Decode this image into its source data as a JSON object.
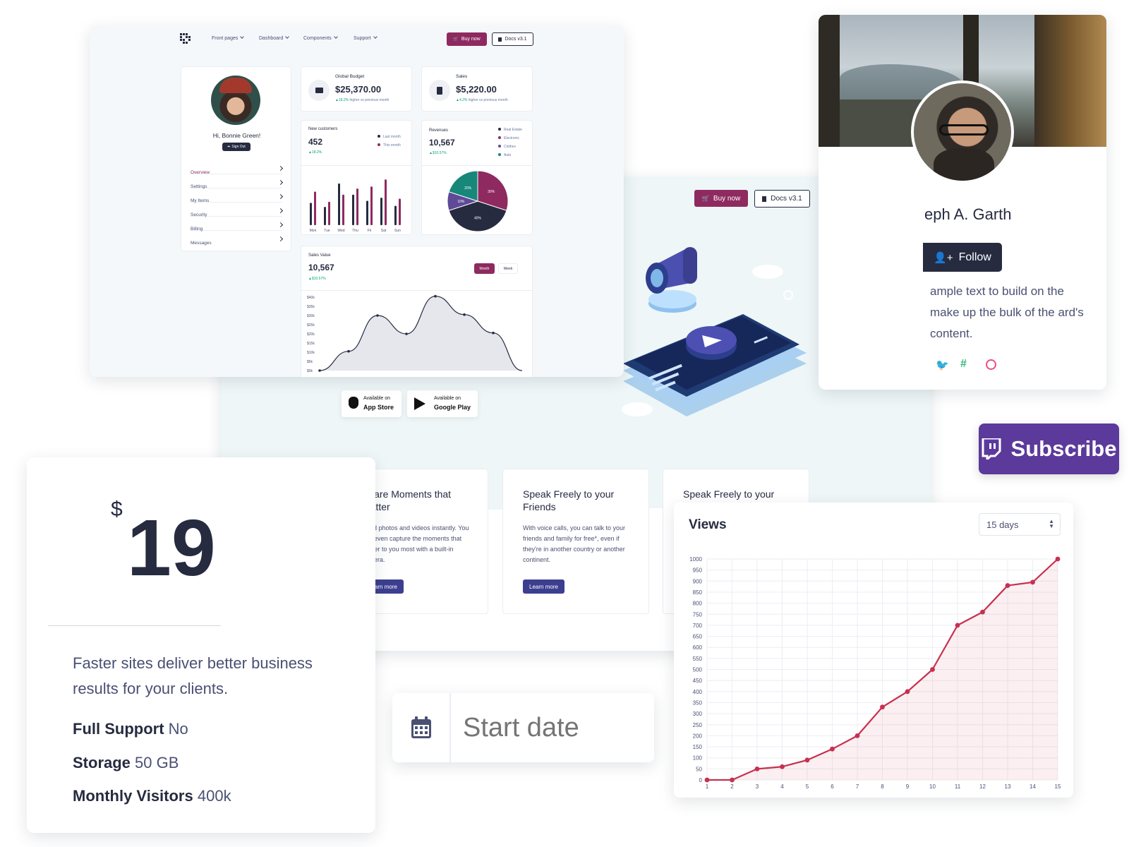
{
  "dashboard": {
    "nav": [
      "Front pages",
      "Dashboard",
      "Components",
      "Support"
    ],
    "buy_now": "Buy now",
    "docs": "Docs v3.1",
    "greeting": "Hi, Bonnie Green!",
    "sign_out": "Sign Out",
    "menu": [
      "Overview",
      "Settings",
      "My Items",
      "Security",
      "Billing",
      "Messages"
    ],
    "global_budget": {
      "label": "Global Budget",
      "value": "$25,370.00",
      "change": "18.2%",
      "note": "higher vs previous month"
    },
    "sales": {
      "label": "Sales",
      "value": "$5,220.00",
      "change": "4.2%",
      "note": "higher vs previous month"
    },
    "new_customers": {
      "label": "New customers",
      "value": "452",
      "change": "18.2%",
      "legend": [
        "Last month",
        "This month"
      ]
    },
    "revenues": {
      "label": "Revenues",
      "value": "10,567",
      "change": "$10.57%",
      "legend": [
        "Real Estate",
        "Electronic",
        "Clothes",
        "Auto"
      ]
    },
    "sales_value": {
      "label": "Sales Value",
      "value": "10,567",
      "change": "$10.57%",
      "month": "Month",
      "week": "Week"
    }
  },
  "landing": {
    "buy_now": "Buy now",
    "docs": "Docs v3.1",
    "app_store": {
      "small": "Available on",
      "big": "App Store"
    },
    "google_play": {
      "small": "Available on",
      "big": "Google Play"
    },
    "features": [
      {
        "title": "Share Moments that Matter",
        "text": "Send photos and videos instantly. You can even capture the moments that matter to you most with a built-in camera.",
        "button": "Learn more"
      },
      {
        "title": "Speak Freely to your Friends",
        "text": "With voice calls, you can talk to your friends and family for free*, even if they're in another country or another continent.",
        "button": "Learn more"
      },
      {
        "title": "Speak Freely to your",
        "text": "",
        "button": ""
      }
    ]
  },
  "profile": {
    "name": "eph A. Garth",
    "follow": "Follow",
    "text": "ample text to build on the make up the bulk of the ard's content."
  },
  "subscribe": {
    "label": "Subscribe"
  },
  "pricing": {
    "currency": "$",
    "price": "19",
    "description": "Faster sites deliver better business results for your clients.",
    "features": [
      {
        "label": "Full Support",
        "value": "No"
      },
      {
        "label": "Storage",
        "value": "50 GB"
      },
      {
        "label": "Monthly Visitors",
        "value": "400k"
      }
    ]
  },
  "date_input": {
    "placeholder": "Start date"
  },
  "views": {
    "title": "Views",
    "range": "15 days"
  },
  "chart_data": [
    {
      "type": "bar",
      "title": "New customers",
      "categories": [
        "Mon",
        "Tue",
        "Wed",
        "Thu",
        "Fri",
        "Sat",
        "Sun"
      ],
      "series": [
        {
          "name": "Last month",
          "values": [
            2.2,
            1.8,
            4.1,
            3.0,
            2.4,
            2.7,
            1.9
          ]
        },
        {
          "name": "This month",
          "values": [
            3.3,
            2.3,
            3.0,
            3.6,
            3.8,
            4.5,
            2.6
          ]
        }
      ],
      "colors": [
        "#262b40",
        "#8e2a5f"
      ]
    },
    {
      "type": "pie",
      "title": "Revenues",
      "labels": [
        "Real Estate",
        "Electronic",
        "Clothes",
        "Auto"
      ],
      "values": [
        30,
        40,
        10,
        20
      ],
      "colors": [
        "#8e2a5f",
        "#262b40",
        "#5e4a96",
        "#17877a"
      ]
    },
    {
      "type": "area",
      "title": "Sales Value",
      "x": [
        0,
        1,
        2,
        3,
        4,
        5,
        6,
        7
      ],
      "y": [
        0,
        10.5,
        30,
        20,
        40.5,
        30.5,
        20.5,
        0
      ],
      "yticks": [
        "$0k",
        "$5k",
        "$10k",
        "$15k",
        "$20k",
        "$25k",
        "$30k",
        "$35k",
        "$40k"
      ],
      "ylim": [
        0,
        40
      ]
    },
    {
      "type": "area",
      "title": "Views",
      "x": [
        1,
        2,
        3,
        4,
        5,
        6,
        7,
        8,
        9,
        10,
        11,
        12,
        13,
        14,
        15
      ],
      "y": [
        0,
        0,
        50,
        60,
        90,
        140,
        200,
        330,
        400,
        500,
        700,
        760,
        880,
        895,
        1000
      ],
      "ylim": [
        0,
        1000
      ],
      "yticks": [
        0,
        50,
        100,
        150,
        200,
        250,
        300,
        350,
        400,
        450,
        500,
        550,
        600,
        650,
        700,
        750,
        800,
        850,
        900,
        950,
        1000
      ],
      "xticks": [
        1,
        2,
        3,
        4,
        5,
        6,
        7,
        8,
        9,
        10,
        11,
        12,
        13,
        14,
        15
      ],
      "grid": true,
      "color": "#c7304f"
    }
  ],
  "colors": {
    "primary": "#262b40",
    "plum": "#8e2a5f",
    "indigo": "#3c3f8f",
    "twitch": "#5c3a9b",
    "line": "#c7304f"
  }
}
